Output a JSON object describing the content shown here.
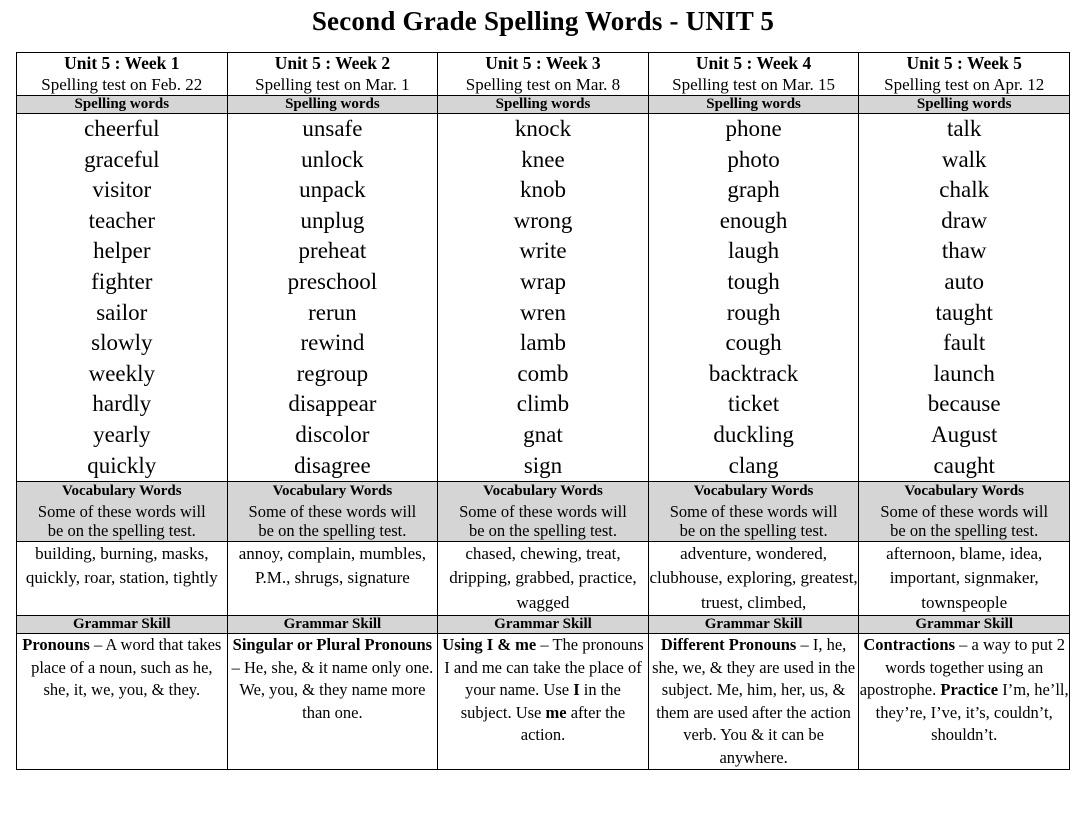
{
  "document": {
    "title": "Second Grade Spelling Words - UNIT 5"
  },
  "labels": {
    "spelling_words": "Spelling words",
    "vocabulary_title": "Vocabulary Words",
    "vocabulary_sub_line1": "Some of these words will",
    "vocabulary_sub_line2": "be on the spelling test.",
    "grammar_skill": "Grammar Skill"
  },
  "colors": {
    "band_gray": "#d5d5d5",
    "border": "#000000",
    "text": "#000000",
    "page_background": "#ffffff"
  },
  "weeks": [
    {
      "title": "Unit 5 : Week 1",
      "test_date": "Spelling test on Feb. 22",
      "spelling_words": [
        "cheerful",
        "graceful",
        "visitor",
        "teacher",
        "helper",
        "fighter",
        "sailor",
        "slowly",
        "weekly",
        "hardly",
        "yearly",
        "quickly"
      ],
      "vocabulary_words": "building, burning, masks, quickly, roar, station, tightly",
      "grammar": {
        "lead": "Pronouns",
        "body": " – A word that takes place of a noun, such as he, she, it, we, you, & they."
      }
    },
    {
      "title": "Unit 5 : Week 2",
      "test_date": "Spelling test on Mar. 1",
      "spelling_words": [
        "unsafe",
        "unlock",
        "unpack",
        "unplug",
        "preheat",
        "preschool",
        "rerun",
        "rewind",
        "regroup",
        "disappear",
        "discolor",
        "disagree"
      ],
      "vocabulary_words": "annoy, complain, mumbles, P.M., shrugs, signature",
      "grammar": {
        "lead": "Singular or Plural Pronouns",
        "body": " – He, she, & it name only one.  We, you, & they name more than one."
      }
    },
    {
      "title": "Unit 5 : Week 3",
      "test_date": "Spelling test on Mar. 8",
      "spelling_words": [
        "knock",
        "knee",
        "knob",
        "wrong",
        "write",
        "wrap",
        "wren",
        "lamb",
        "comb",
        "climb",
        "gnat",
        "sign"
      ],
      "vocabulary_words": "chased, chewing, treat, dripping, grabbed, practice, wagged",
      "grammar": {
        "lead": "Using I & me",
        "body": " – The pronouns I and me can take the place of your name.  Use ",
        "bold2": "I",
        "body2": " in the subject.  Use ",
        "bold3": "me",
        "body3": " after the action."
      }
    },
    {
      "title": "Unit 5 : Week 4",
      "test_date": "Spelling test on Mar. 15",
      "spelling_words": [
        "phone",
        "photo",
        "graph",
        "enough",
        "laugh",
        "tough",
        "rough",
        "cough",
        "backtrack",
        "ticket",
        "duckling",
        "clang"
      ],
      "vocabulary_words": "adventure, wondered, clubhouse, exploring, greatest, truest, climbed,",
      "grammar": {
        "lead": "Different Pronouns",
        "body": " – I, he, she, we, & they are used in the subject.  Me, him, her, us, & them are used after the action verb. You & it can be anywhere."
      }
    },
    {
      "title": "Unit 5 : Week 5",
      "test_date": "Spelling test on Apr. 12",
      "spelling_words": [
        "talk",
        "walk",
        "chalk",
        "draw",
        "thaw",
        "auto",
        "taught",
        "fault",
        "launch",
        "because",
        "August",
        "caught"
      ],
      "vocabulary_words": "afternoon, blame, idea, important, signmaker, townspeople",
      "grammar": {
        "lead": "Contractions",
        "body": " – a way to put 2 words together using an apostrophe.  ",
        "bold2": "Practice",
        "body2": " I’m, he’ll, they’re, I’ve, it’s, couldn’t, shouldn’t."
      }
    }
  ]
}
